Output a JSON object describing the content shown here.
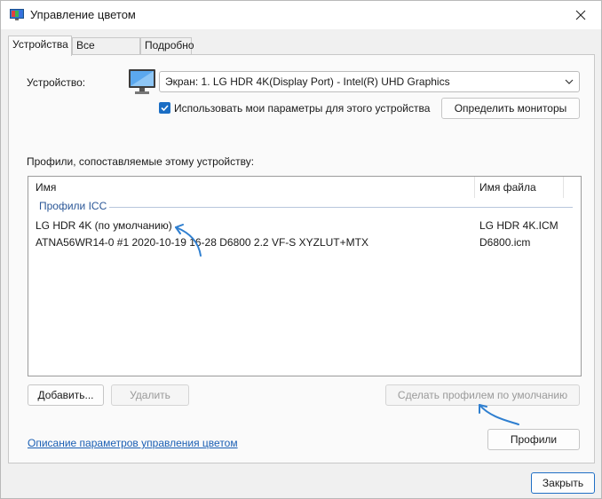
{
  "window": {
    "title": "Управление цветом",
    "close_glyph": "✕"
  },
  "tabs": [
    {
      "label": "Устройства",
      "active": true
    },
    {
      "label": "Все профили",
      "active": false
    },
    {
      "label": "Подробно",
      "active": false
    }
  ],
  "device": {
    "label": "Устройство:",
    "selected": "Экран: 1. LG HDR 4K(Display Port) - Intel(R) UHD Graphics",
    "use_my_settings_label": "Использовать мои параметры для этого устройства",
    "use_my_settings_checked": true,
    "identify_button": "Определить мониторы"
  },
  "profiles": {
    "section_label": "Профили, сопоставляемые этому устройству:",
    "columns": [
      "Имя",
      "Имя файла"
    ],
    "group_label": "Профили ICC",
    "rows": [
      {
        "name": "LG HDR 4K (по умолчанию)",
        "file": "LG HDR 4K.ICM"
      },
      {
        "name": "ATNA56WR14-0 #1 2020-10-19 16-28 D6800 2.2 VF-S XYZLUT+MTX",
        "file": "D6800.icm"
      }
    ]
  },
  "buttons": {
    "add": "Добавить...",
    "remove": "Удалить",
    "set_default": "Сделать профилем по умолчанию",
    "profiles": "Профили",
    "close": "Закрыть"
  },
  "link_text": "Описание параметров управления цветом",
  "colors": {
    "accent": "#1a6dc4",
    "annotation_arrow": "#2f7fd0",
    "link": "#1a5fb4"
  },
  "icons": [
    "color-management-icon",
    "close-icon",
    "monitor-icon",
    "chevron-down-icon",
    "checkmark-icon",
    "annotation-arrow-icon"
  ]
}
